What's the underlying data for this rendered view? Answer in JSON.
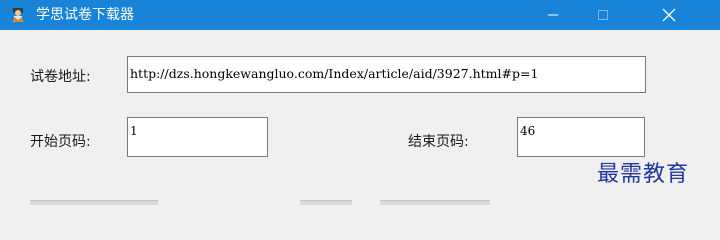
{
  "window": {
    "title": "学思试卷下载器",
    "title_bar_color": "#1883d7",
    "app_icon": "app-logo-icon",
    "controls": {
      "minimize_icon": "minimize-icon",
      "maximize_icon": "maximize-icon",
      "close_icon": "close-icon"
    }
  },
  "form": {
    "url_label": "试卷地址:",
    "url_value": "http://dzs.hongkewangluo.com/Index/article/aid/3927.html#p=1",
    "start_label": "开始页码:",
    "start_value": "1",
    "end_label": "结束页码:",
    "end_value": "46"
  },
  "watermark": {
    "text": "最需教育",
    "color": "#2337a0"
  }
}
